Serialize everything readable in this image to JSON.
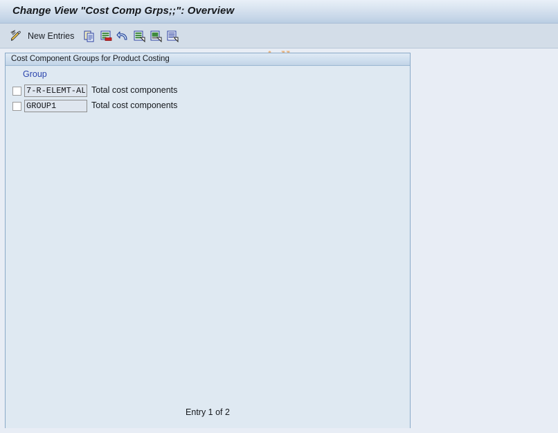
{
  "window": {
    "title": "Change View \"Cost Comp Grps;;\": Overview"
  },
  "toolbar": {
    "edit_icon_name": "pencil-edit-icon",
    "new_entries_label": "New Entries",
    "buttons": [
      {
        "name": "copy-icon",
        "title": "Copy As..."
      },
      {
        "name": "delete-icon",
        "title": "Delete"
      },
      {
        "name": "undo-icon",
        "title": "Undo Change"
      },
      {
        "name": "select-all-icon",
        "title": "Select All"
      },
      {
        "name": "deselect-all-icon",
        "title": "Deselect All"
      },
      {
        "name": "select-block-icon",
        "title": "Select Block"
      }
    ]
  },
  "watermark": {
    "text": "www.tutorialkart.com",
    "color": "#e7b380"
  },
  "panel": {
    "header": "Cost Component Groups for Product Costing",
    "columns": {
      "group": "Group",
      "description": ""
    },
    "rows": [
      {
        "checked": false,
        "group": "7-R-ELEMT-AL",
        "description": "Total cost components"
      },
      {
        "checked": false,
        "group": "GROUP1",
        "description": "Total cost components"
      }
    ],
    "status": "Entry 1 of 2"
  },
  "colors": {
    "title_bar_accent": "#b9cde2",
    "panel_border": "#8aaac8",
    "header_text_link": "#2b45ad",
    "background": "#e8edf5"
  }
}
